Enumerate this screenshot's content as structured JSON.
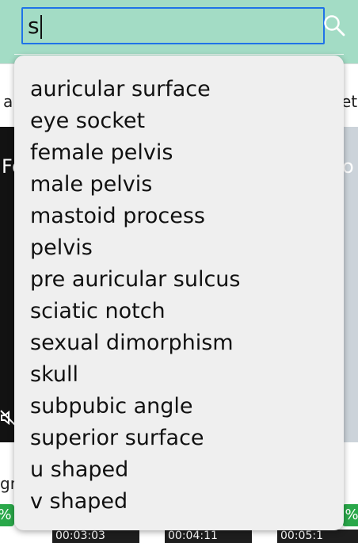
{
  "search": {
    "value": "s"
  },
  "icons": {
    "search": "search-icon",
    "mute": "muted-speaker-icon"
  },
  "background": {
    "tag_left": "ar",
    "tag_right": "et",
    "video_left_text": "Fo",
    "video_right_text": "o",
    "gm_text": "gm",
    "badge_left": "%",
    "badge_right": "%",
    "thumb_1": "00:03:03",
    "thumb_2": "00:04:11",
    "thumb_3": "00:05:1"
  },
  "suggestions": [
    "auricular surface",
    "eye socket",
    "female pelvis",
    "male pelvis",
    "mastoid process",
    "pelvis",
    "pre auricular sulcus",
    "sciatic notch",
    "sexual dimorphism",
    "skull",
    "subpubic angle",
    "superior surface",
    "u shaped",
    "v shaped"
  ],
  "colors": {
    "header_bg": "#a3dcc5",
    "focus_border": "#1f73e8",
    "dropdown_bg": "#efefef",
    "badge": "#2aa84a"
  }
}
